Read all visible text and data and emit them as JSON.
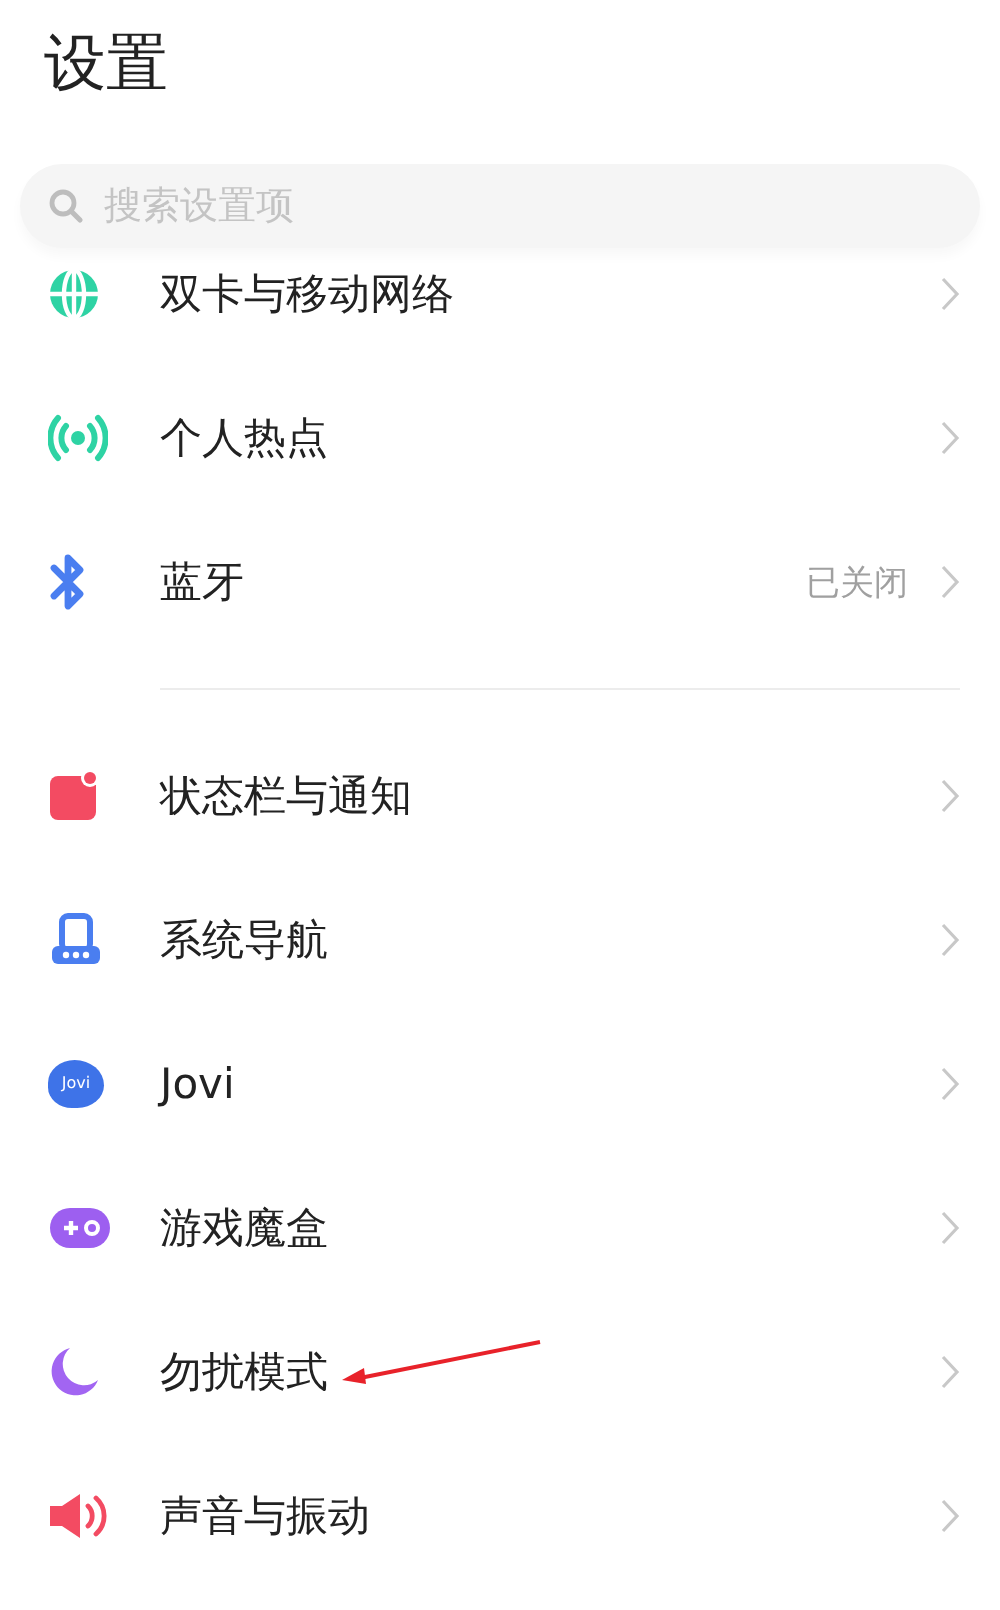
{
  "title": "设置",
  "search": {
    "placeholder": "搜索设置项"
  },
  "groups": [
    {
      "items": [
        {
          "kind": "globe",
          "label": "双卡与移动网络"
        },
        {
          "kind": "hotspot",
          "label": "个人热点"
        },
        {
          "kind": "bluetooth",
          "label": "蓝牙",
          "value": "已关闭"
        }
      ]
    },
    {
      "items": [
        {
          "kind": "notification",
          "label": "状态栏与通知"
        },
        {
          "kind": "navigation",
          "label": "系统导航"
        },
        {
          "kind": "blob",
          "label": "Jovi",
          "icon_text": "Jovi"
        },
        {
          "kind": "gamepad",
          "label": "游戏魔盒"
        },
        {
          "kind": "moon",
          "label": "勿扰模式"
        },
        {
          "kind": "speaker",
          "label": "声音与振动"
        }
      ]
    }
  ]
}
